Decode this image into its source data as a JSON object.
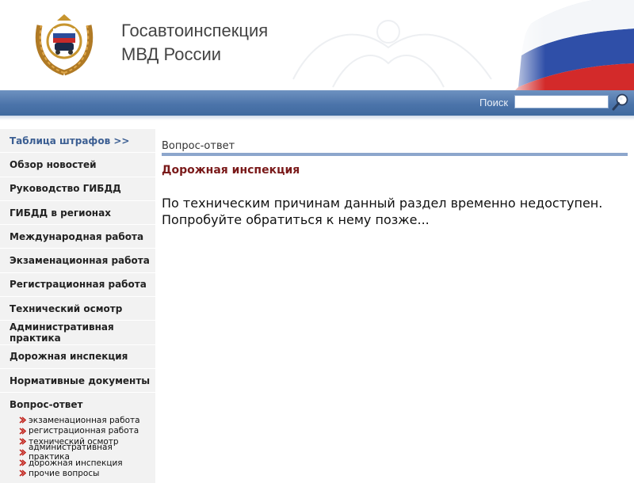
{
  "header": {
    "title_line1": "Госавтоинспекция",
    "title_line2": "МВД России"
  },
  "search": {
    "label": "Поиск",
    "value": "",
    "placeholder": ""
  },
  "sidebar": {
    "items": [
      {
        "label": "Таблица штрафов >>"
      },
      {
        "label": "Обзор новостей"
      },
      {
        "label": "Руководство ГИБДД"
      },
      {
        "label": "ГИБДД в регионах"
      },
      {
        "label": "Международная работа"
      },
      {
        "label": "Экзаменационная работа"
      },
      {
        "label": "Регистрационная работа"
      },
      {
        "label": "Технический осмотр"
      },
      {
        "label": "Административная практика"
      },
      {
        "label": "Дорожная инспекция"
      },
      {
        "label": "Нормативные документы"
      },
      {
        "label": "Вопрос-ответ"
      }
    ],
    "subitems": [
      {
        "label": "экзаменационная работа"
      },
      {
        "label": "регистрационная работа"
      },
      {
        "label": "технический осмотр"
      },
      {
        "label": "административная практика"
      },
      {
        "label": "дорожная инспекция"
      },
      {
        "label": "прочие вопросы"
      }
    ]
  },
  "main": {
    "section_title": "Вопрос-ответ",
    "heading": "Дорожная инспекция",
    "message_line1": "По техническим причинам данный раздел временно недоступен.",
    "message_line2": "Попробуйте обратиться к нему позже..."
  },
  "colors": {
    "band": "#4c74aa",
    "heading": "#7a1a1a",
    "active_link": "#3b5e92",
    "rule": "#8da6cc"
  }
}
